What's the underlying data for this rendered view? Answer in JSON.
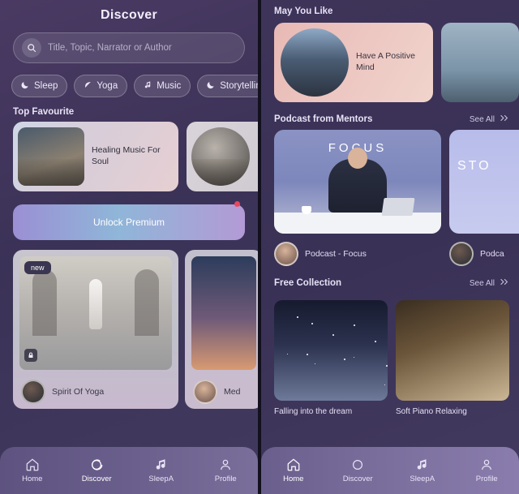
{
  "left": {
    "title": "Discover",
    "search": {
      "placeholder": "Title, Topic, Narrator or Author",
      "icon": "search-icon"
    },
    "chips": [
      {
        "label": "Sleep",
        "icon": "moon-icon"
      },
      {
        "label": "Yoga",
        "icon": "leaf-icon"
      },
      {
        "label": "Music",
        "icon": "music-note-icon"
      },
      {
        "label": "Storytelling",
        "icon": "moon-icon"
      }
    ],
    "favourite_section": "Top Favourite",
    "favourites": [
      {
        "label": "Healing Music For Soul"
      },
      {
        "label": ""
      }
    ],
    "premium": {
      "label": "Unlock Premium"
    },
    "big_cards": [
      {
        "badge": "new",
        "label": "Spirit Of Yoga"
      },
      {
        "badge": "",
        "label": "Med"
      }
    ],
    "nav": [
      {
        "label": "Home",
        "icon": "home-icon",
        "active": false
      },
      {
        "label": "Discover",
        "icon": "chat-icon",
        "active": true
      },
      {
        "label": "SleepA",
        "icon": "music-note-icon",
        "active": false
      },
      {
        "label": "Profile",
        "icon": "person-icon",
        "active": false
      }
    ]
  },
  "right": {
    "may_you_like": {
      "title": "May You Like",
      "cards": [
        {
          "label": "Have A Positive Mind"
        },
        {
          "label": ""
        }
      ]
    },
    "mentors": {
      "title": "Podcast from Mentors",
      "see_all": "See All",
      "cards": [
        {
          "overlay": "FOCUS",
          "name": "Podcast - Focus"
        },
        {
          "overlay": "STO",
          "name": "Podca"
        }
      ]
    },
    "free_collection": {
      "title": "Free Collection",
      "see_all": "See All",
      "cards": [
        {
          "label": "Falling into the dream"
        },
        {
          "label": "Soft Piano Relaxing"
        }
      ]
    },
    "nav": [
      {
        "label": "Home",
        "icon": "home-icon",
        "active": true
      },
      {
        "label": "Discover",
        "icon": "chat-icon",
        "active": false
      },
      {
        "label": "SleepA",
        "icon": "music-note-icon",
        "active": false
      },
      {
        "label": "Profile",
        "icon": "person-icon",
        "active": false
      }
    ]
  }
}
